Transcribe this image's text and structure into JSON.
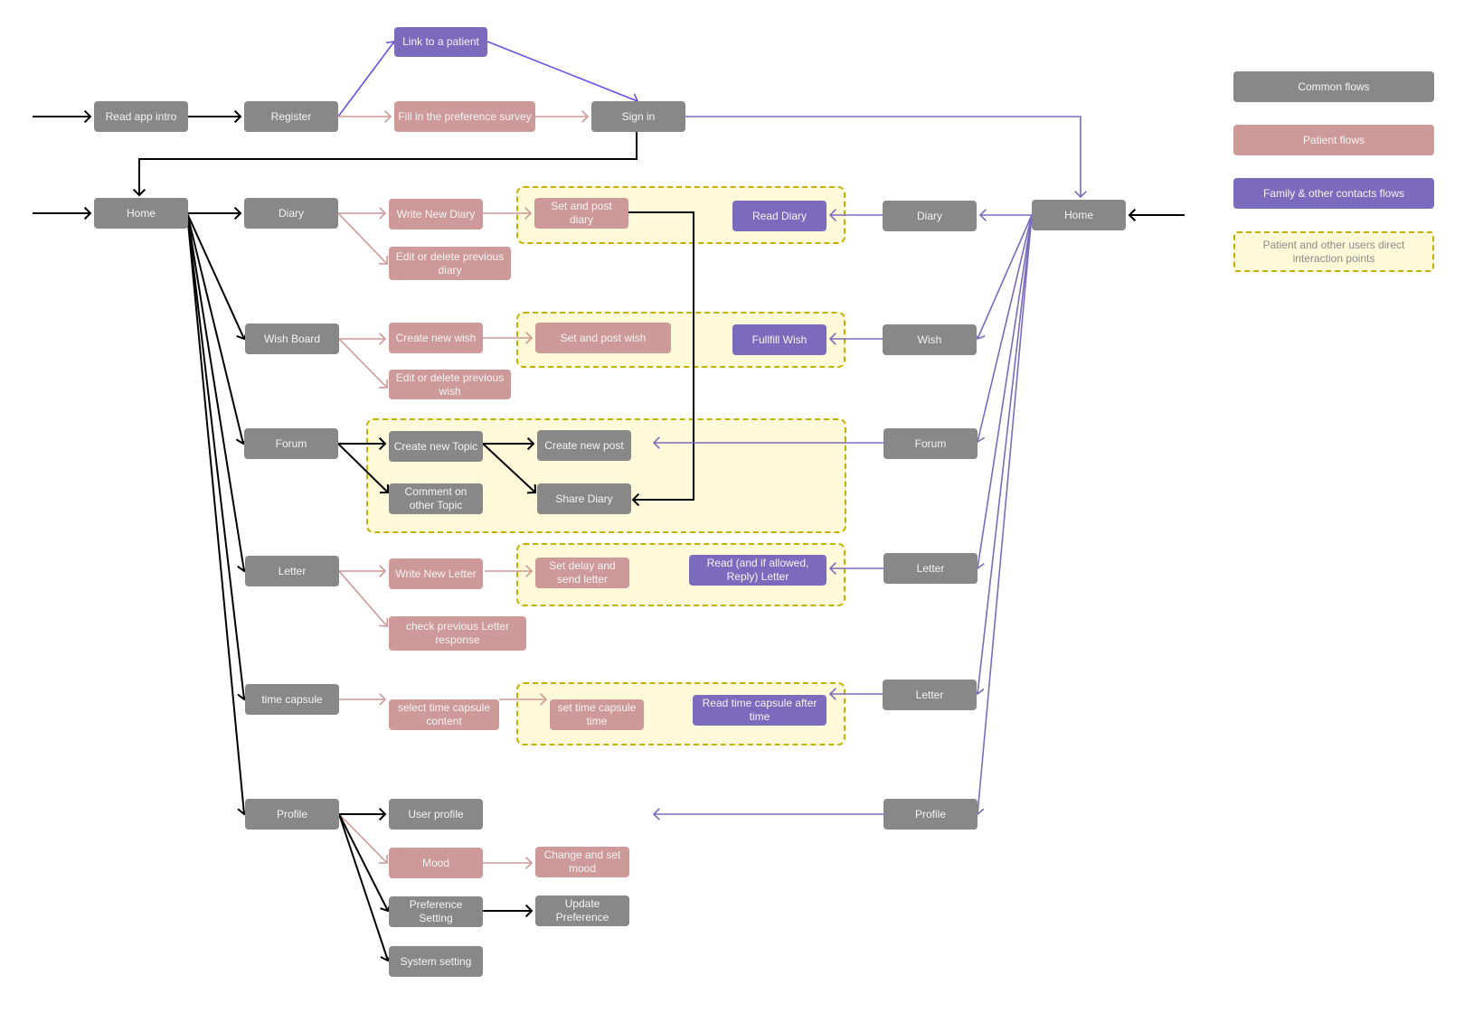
{
  "colors": {
    "common": "#888888",
    "patient": "#cd9999",
    "family": "#7b6bbd",
    "interaction_fill": "#fef9d9",
    "interaction_border": "#c4b000",
    "edge_common": "#000000",
    "edge_patient": "#cd9999",
    "edge_family": "#7b6bbd",
    "edge_family_bright": "#6b4fe8"
  },
  "legend": [
    {
      "id": "common",
      "label": "Common flows"
    },
    {
      "id": "patient",
      "label": "Patient flows"
    },
    {
      "id": "family",
      "label": "Family & other contacts flows"
    },
    {
      "id": "interaction",
      "label": "Patient and other users direct interaction points"
    }
  ],
  "nodes": {
    "read_app_intro": {
      "label": "Read app intro",
      "type": "common"
    },
    "register": {
      "label": "Register",
      "type": "common"
    },
    "link_patient": {
      "label": "Link to a patient",
      "type": "family"
    },
    "fill_survey": {
      "label": "Fill in the preference survey",
      "type": "patient"
    },
    "sign_in": {
      "label": "Sign in",
      "type": "common"
    },
    "home": {
      "label": "Home",
      "type": "common"
    },
    "diary": {
      "label": "Diary",
      "type": "common"
    },
    "write_diary": {
      "label": "Write New Diary",
      "type": "patient"
    },
    "edit_diary": {
      "label": "Edit or delete previous diary",
      "type": "patient"
    },
    "post_diary": {
      "label": "Set and post diary",
      "type": "patient"
    },
    "read_diary": {
      "label": "Read Diary",
      "type": "family"
    },
    "wish_board": {
      "label": "Wish Board",
      "type": "common"
    },
    "create_wish": {
      "label": "Create new wish",
      "type": "patient"
    },
    "edit_wish": {
      "label": "Edit or delete previous wish",
      "type": "patient"
    },
    "post_wish": {
      "label": "Set and post wish",
      "type": "patient"
    },
    "fulfill_wish": {
      "label": "Fullfill Wish",
      "type": "family"
    },
    "forum": {
      "label": "Forum",
      "type": "common"
    },
    "create_topic": {
      "label": "Create new Topic",
      "type": "common"
    },
    "comment_topic": {
      "label": "Comment on other Topic",
      "type": "common"
    },
    "create_post": {
      "label": "Create new post",
      "type": "common"
    },
    "share_diary": {
      "label": "Share Diary",
      "type": "common"
    },
    "letter": {
      "label": "Letter",
      "type": "common"
    },
    "write_letter": {
      "label": "Write New Letter",
      "type": "patient"
    },
    "check_letter": {
      "label": "check previous Letter response",
      "type": "patient"
    },
    "send_letter": {
      "label": "Set delay and send letter",
      "type": "patient"
    },
    "read_letter": {
      "label": "Read (and if allowed, Reply) Letter",
      "type": "family"
    },
    "time_capsule": {
      "label": "time capsule",
      "type": "common"
    },
    "select_capsule": {
      "label": "select time capsule content",
      "type": "patient"
    },
    "set_capsule_time": {
      "label": "set time capsule time",
      "type": "patient"
    },
    "read_capsule": {
      "label": "Read time capsule after time",
      "type": "family"
    },
    "profile": {
      "label": "Profile",
      "type": "common"
    },
    "user_profile": {
      "label": "User profile",
      "type": "common"
    },
    "mood": {
      "label": "Mood",
      "type": "patient"
    },
    "set_mood": {
      "label": "Change and set mood",
      "type": "patient"
    },
    "pref_setting": {
      "label": "Preference Setting",
      "type": "common"
    },
    "update_pref": {
      "label": "Update Preference",
      "type": "common"
    },
    "system_setting": {
      "label": "System setting",
      "type": "common"
    },
    "r_home": {
      "label": "Home",
      "type": "common"
    },
    "r_diary": {
      "label": "Diary",
      "type": "common"
    },
    "r_wish": {
      "label": "Wish",
      "type": "common"
    },
    "r_forum": {
      "label": "Forum",
      "type": "common"
    },
    "r_letter": {
      "label": "Letter",
      "type": "common"
    },
    "r_letter2": {
      "label": "Letter",
      "type": "common"
    },
    "r_profile": {
      "label": "Profile",
      "type": "common"
    }
  },
  "edges": [
    {
      "from": "entry_top",
      "to": "read_app_intro",
      "kind": "common"
    },
    {
      "from": "read_app_intro",
      "to": "register",
      "kind": "common"
    },
    {
      "from": "register",
      "to": "link_patient",
      "kind": "family_bright"
    },
    {
      "from": "register",
      "to": "fill_survey",
      "kind": "patient"
    },
    {
      "from": "link_patient",
      "to": "sign_in",
      "kind": "family_bright"
    },
    {
      "from": "fill_survey",
      "to": "sign_in",
      "kind": "patient"
    },
    {
      "from": "sign_in",
      "to": "home",
      "kind": "common"
    },
    {
      "from": "sign_in",
      "to": "r_home",
      "kind": "family"
    },
    {
      "from": "entry_home",
      "to": "home",
      "kind": "common"
    },
    {
      "from": "home",
      "to": "diary",
      "kind": "common"
    },
    {
      "from": "home",
      "to": "wish_board",
      "kind": "common"
    },
    {
      "from": "home",
      "to": "forum",
      "kind": "common"
    },
    {
      "from": "home",
      "to": "letter",
      "kind": "common"
    },
    {
      "from": "home",
      "to": "time_capsule",
      "kind": "common"
    },
    {
      "from": "home",
      "to": "profile",
      "kind": "common"
    },
    {
      "from": "diary",
      "to": "write_diary",
      "kind": "patient"
    },
    {
      "from": "diary",
      "to": "edit_diary",
      "kind": "patient"
    },
    {
      "from": "write_diary",
      "to": "post_diary",
      "kind": "patient"
    },
    {
      "from": "post_diary",
      "to": "share_diary",
      "kind": "common"
    },
    {
      "from": "wish_board",
      "to": "create_wish",
      "kind": "patient"
    },
    {
      "from": "wish_board",
      "to": "edit_wish",
      "kind": "patient"
    },
    {
      "from": "create_wish",
      "to": "post_wish",
      "kind": "patient"
    },
    {
      "from": "forum",
      "to": "create_topic",
      "kind": "common"
    },
    {
      "from": "forum",
      "to": "comment_topic",
      "kind": "common"
    },
    {
      "from": "create_topic",
      "to": "create_post",
      "kind": "common"
    },
    {
      "from": "create_topic",
      "to": "share_diary",
      "kind": "common"
    },
    {
      "from": "letter",
      "to": "write_letter",
      "kind": "patient"
    },
    {
      "from": "letter",
      "to": "check_letter",
      "kind": "patient"
    },
    {
      "from": "write_letter",
      "to": "send_letter",
      "kind": "patient"
    },
    {
      "from": "time_capsule",
      "to": "select_capsule",
      "kind": "patient"
    },
    {
      "from": "select_capsule",
      "to": "set_capsule_time",
      "kind": "patient"
    },
    {
      "from": "profile",
      "to": "user_profile",
      "kind": "common"
    },
    {
      "from": "profile",
      "to": "mood",
      "kind": "patient"
    },
    {
      "from": "profile",
      "to": "pref_setting",
      "kind": "common"
    },
    {
      "from": "profile",
      "to": "system_setting",
      "kind": "common"
    },
    {
      "from": "mood",
      "to": "set_mood",
      "kind": "patient"
    },
    {
      "from": "pref_setting",
      "to": "update_pref",
      "kind": "common"
    },
    {
      "from": "entry_r_home",
      "to": "r_home",
      "kind": "common"
    },
    {
      "from": "r_home",
      "to": "r_diary",
      "kind": "family"
    },
    {
      "from": "r_home",
      "to": "r_wish",
      "kind": "family"
    },
    {
      "from": "r_home",
      "to": "r_forum",
      "kind": "family"
    },
    {
      "from": "r_home",
      "to": "r_letter",
      "kind": "family"
    },
    {
      "from": "r_home",
      "to": "r_letter2",
      "kind": "family"
    },
    {
      "from": "r_home",
      "to": "r_profile",
      "kind": "family"
    },
    {
      "from": "r_diary",
      "to": "read_diary",
      "kind": "family"
    },
    {
      "from": "r_wish",
      "to": "fulfill_wish",
      "kind": "family"
    },
    {
      "from": "r_forum",
      "to": "forum_zone",
      "kind": "family"
    },
    {
      "from": "r_letter",
      "to": "read_letter",
      "kind": "family"
    },
    {
      "from": "r_letter2",
      "to": "read_capsule",
      "kind": "family"
    },
    {
      "from": "r_profile",
      "to": "profile_area",
      "kind": "family"
    }
  ]
}
